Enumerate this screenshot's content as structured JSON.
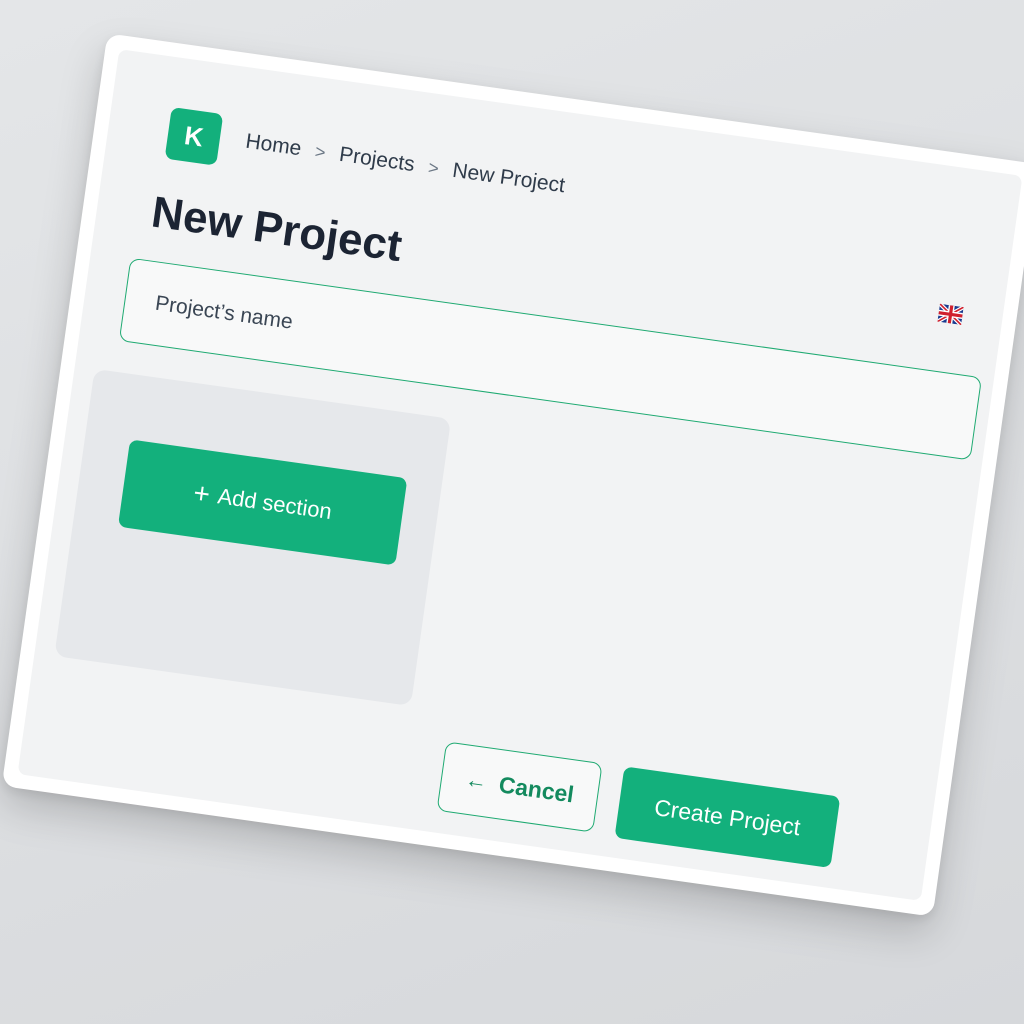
{
  "app": {
    "logo_letter": "K",
    "accent_color": "#13b07c"
  },
  "breadcrumb": {
    "items": [
      "Home",
      "Projects",
      "New Project"
    ],
    "separator": ">"
  },
  "page": {
    "title": "New Project",
    "language_icon": "uk-flag-icon"
  },
  "form": {
    "name_placeholder": "Project’s name",
    "name_value": ""
  },
  "sections": {
    "add_label": "Add section",
    "add_icon": "plus-icon"
  },
  "actions": {
    "cancel_label": "Cancel",
    "cancel_icon": "arrow-left-icon",
    "create_label": "Create Project"
  }
}
